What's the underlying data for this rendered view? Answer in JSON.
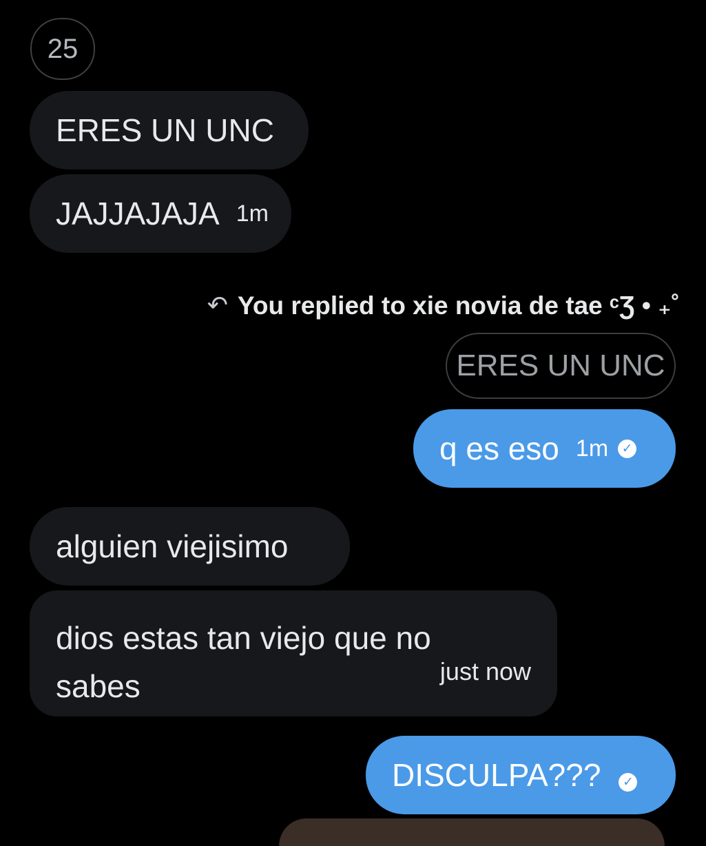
{
  "reaction_count": "25",
  "messages": [
    {
      "text": "ERES UN UNC"
    },
    {
      "text": "JAJJAJAJA",
      "time": "1m"
    },
    {
      "text": "q es eso",
      "time": "1m"
    },
    {
      "text": "alguien viejisimo"
    },
    {
      "text_line1": "dios estas tan viejo que no",
      "text_line2": "sabes",
      "time": "just now"
    },
    {
      "text": "DISCULPA???"
    }
  ],
  "reply": {
    "note": "You replied to xie novia de tae ᶜƷ • ₊˚",
    "quoted": "ERES UN UNC"
  },
  "colors": {
    "background": "#000000",
    "incoming_bubble": "#16181c",
    "outgoing_bubble": "#4a9ae8"
  },
  "icons": {
    "reply": "reply-arrow-icon",
    "sent": "check-circle-icon"
  }
}
